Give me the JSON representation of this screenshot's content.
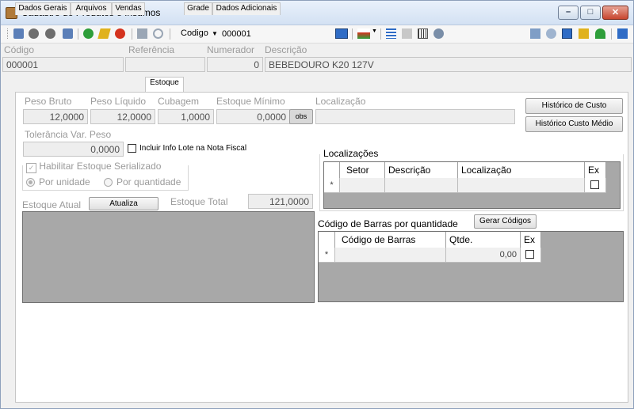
{
  "window": {
    "title": "Cadastro de Produtos e Insumos",
    "minimize_label": "–",
    "maximize_label": "□",
    "close_label": "✕"
  },
  "toolbar": {
    "search_field_label": "Codigo",
    "search_value": "000001",
    "colors": {
      "green": "#2e9e3a",
      "red": "#d4331f",
      "blue": "#2f6cc6",
      "yellow": "#e0b21e"
    }
  },
  "header": {
    "codigo_label": "Código",
    "referencia_label": "Referência",
    "numerador_label": "Numerador",
    "descricao_label": "Descrição",
    "codigo_value": "000001",
    "referencia_value": "",
    "numerador_value": "0",
    "descricao_value": "BEBEDOURO K20 127V"
  },
  "tabs": [
    "Dados Gerais",
    "Arquivos",
    "Vendas",
    "Estoque",
    "Grade",
    "Dados Adicionais"
  ],
  "active_tab": "Estoque",
  "estoque": {
    "peso_bruto_label": "Peso Bruto",
    "peso_liquido_label": "Peso Líquido",
    "cubagem_label": "Cubagem",
    "estoque_minimo_label": "Estoque Mínimo",
    "localizacao_label": "Localização",
    "peso_bruto_value": "12,0000",
    "peso_liquido_value": "12,0000",
    "cubagem_value": "1,0000",
    "estoque_minimo_value": "0,0000",
    "obs_label": "obs",
    "localizacao_value": "",
    "tolerancia_label": "Tolerância Var. Peso",
    "tolerancia_value": "0,0000",
    "incluir_lote_label": "Incluir Info Lote na Nota Fiscal",
    "habilitar_serializado_label": "Habilitar Estoque Serializado",
    "por_unidade_label": "Por unidade",
    "por_quantidade_label": "Por quantidade",
    "estoque_atual_label": "Estoque Atual",
    "atualiza_label": "Atualiza",
    "estoque_total_label": "Estoque Total",
    "estoque_total_value": "121,0000"
  },
  "buttons": {
    "historico_custo": "Histórico de Custo",
    "historico_custo_medio": "Histórico Custo Médio",
    "gerar_codigos": "Gerar Códigos"
  },
  "localizacoes": {
    "title": "Localizações",
    "columns": [
      "Setor",
      "Descrição",
      "Localização",
      "Ex"
    ],
    "new_row_marker": "*"
  },
  "codigo_barras": {
    "title": "Código de Barras por quantidade",
    "columns": [
      "Código de Barras",
      "Qtde.",
      "Ex"
    ],
    "new_row_marker": "*",
    "qtde_value": "0,00"
  }
}
